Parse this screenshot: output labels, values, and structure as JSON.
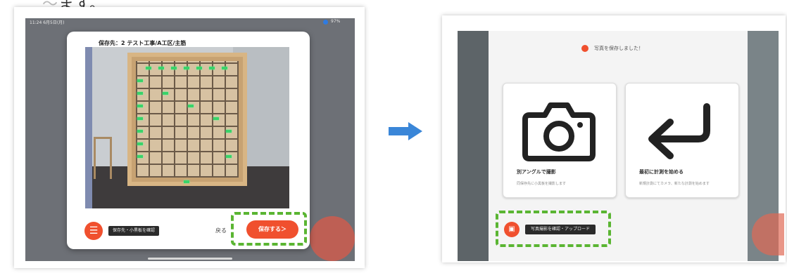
{
  "caption": {
    "text": "ます。"
  },
  "left_screen": {
    "status_time": "11:24 6月5日(月)",
    "status_battery": "97%",
    "dialog": {
      "title": "保存先：2 テスト工事/A工区/主筋",
      "menu_label": "保存先・小黒板を確認",
      "back_label": "戻る",
      "save_label": "保存する＞"
    }
  },
  "right_screen": {
    "title": "写真を保存しました！",
    "options": [
      {
        "title": "別アングルで撮影",
        "desc": "同保存先に小黒板を撮影します"
      },
      {
        "title": "最初に計測を始める",
        "desc": "新規計測にてカメラ、新たな計測を始めます"
      }
    ],
    "gallery_label": "写真撮影を確認・アップロード"
  },
  "colors": {
    "accent": "#f0502e",
    "highlight": "#5ab532",
    "arrow": "#3a86d8"
  },
  "icons": [
    "menu-icon",
    "camera-icon",
    "return-arrow-icon",
    "gallery-icon",
    "right-arrow-icon"
  ]
}
